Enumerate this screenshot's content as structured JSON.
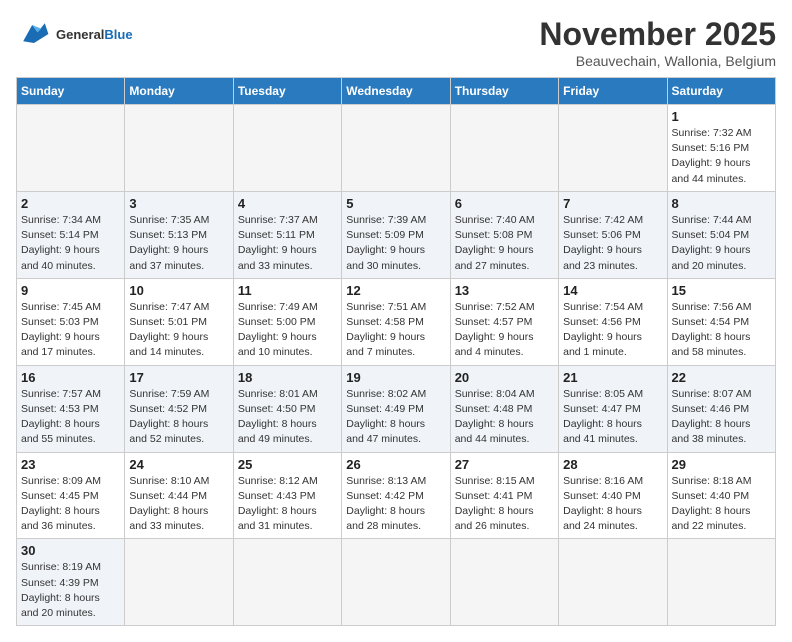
{
  "header": {
    "logo_general": "General",
    "logo_blue": "Blue",
    "month_title": "November 2025",
    "subtitle": "Beauvechain, Wallonia, Belgium"
  },
  "weekdays": [
    "Sunday",
    "Monday",
    "Tuesday",
    "Wednesday",
    "Thursday",
    "Friday",
    "Saturday"
  ],
  "weeks": [
    {
      "days": [
        {
          "num": "",
          "info": ""
        },
        {
          "num": "",
          "info": ""
        },
        {
          "num": "",
          "info": ""
        },
        {
          "num": "",
          "info": ""
        },
        {
          "num": "",
          "info": ""
        },
        {
          "num": "",
          "info": ""
        },
        {
          "num": "1",
          "info": "Sunrise: 7:32 AM\nSunset: 5:16 PM\nDaylight: 9 hours\nand 44 minutes."
        }
      ]
    },
    {
      "days": [
        {
          "num": "2",
          "info": "Sunrise: 7:34 AM\nSunset: 5:14 PM\nDaylight: 9 hours\nand 40 minutes."
        },
        {
          "num": "3",
          "info": "Sunrise: 7:35 AM\nSunset: 5:13 PM\nDaylight: 9 hours\nand 37 minutes."
        },
        {
          "num": "4",
          "info": "Sunrise: 7:37 AM\nSunset: 5:11 PM\nDaylight: 9 hours\nand 33 minutes."
        },
        {
          "num": "5",
          "info": "Sunrise: 7:39 AM\nSunset: 5:09 PM\nDaylight: 9 hours\nand 30 minutes."
        },
        {
          "num": "6",
          "info": "Sunrise: 7:40 AM\nSunset: 5:08 PM\nDaylight: 9 hours\nand 27 minutes."
        },
        {
          "num": "7",
          "info": "Sunrise: 7:42 AM\nSunset: 5:06 PM\nDaylight: 9 hours\nand 23 minutes."
        },
        {
          "num": "8",
          "info": "Sunrise: 7:44 AM\nSunset: 5:04 PM\nDaylight: 9 hours\nand 20 minutes."
        }
      ]
    },
    {
      "days": [
        {
          "num": "9",
          "info": "Sunrise: 7:45 AM\nSunset: 5:03 PM\nDaylight: 9 hours\nand 17 minutes."
        },
        {
          "num": "10",
          "info": "Sunrise: 7:47 AM\nSunset: 5:01 PM\nDaylight: 9 hours\nand 14 minutes."
        },
        {
          "num": "11",
          "info": "Sunrise: 7:49 AM\nSunset: 5:00 PM\nDaylight: 9 hours\nand 10 minutes."
        },
        {
          "num": "12",
          "info": "Sunrise: 7:51 AM\nSunset: 4:58 PM\nDaylight: 9 hours\nand 7 minutes."
        },
        {
          "num": "13",
          "info": "Sunrise: 7:52 AM\nSunset: 4:57 PM\nDaylight: 9 hours\nand 4 minutes."
        },
        {
          "num": "14",
          "info": "Sunrise: 7:54 AM\nSunset: 4:56 PM\nDaylight: 9 hours\nand 1 minute."
        },
        {
          "num": "15",
          "info": "Sunrise: 7:56 AM\nSunset: 4:54 PM\nDaylight: 8 hours\nand 58 minutes."
        }
      ]
    },
    {
      "days": [
        {
          "num": "16",
          "info": "Sunrise: 7:57 AM\nSunset: 4:53 PM\nDaylight: 8 hours\nand 55 minutes."
        },
        {
          "num": "17",
          "info": "Sunrise: 7:59 AM\nSunset: 4:52 PM\nDaylight: 8 hours\nand 52 minutes."
        },
        {
          "num": "18",
          "info": "Sunrise: 8:01 AM\nSunset: 4:50 PM\nDaylight: 8 hours\nand 49 minutes."
        },
        {
          "num": "19",
          "info": "Sunrise: 8:02 AM\nSunset: 4:49 PM\nDaylight: 8 hours\nand 47 minutes."
        },
        {
          "num": "20",
          "info": "Sunrise: 8:04 AM\nSunset: 4:48 PM\nDaylight: 8 hours\nand 44 minutes."
        },
        {
          "num": "21",
          "info": "Sunrise: 8:05 AM\nSunset: 4:47 PM\nDaylight: 8 hours\nand 41 minutes."
        },
        {
          "num": "22",
          "info": "Sunrise: 8:07 AM\nSunset: 4:46 PM\nDaylight: 8 hours\nand 38 minutes."
        }
      ]
    },
    {
      "days": [
        {
          "num": "23",
          "info": "Sunrise: 8:09 AM\nSunset: 4:45 PM\nDaylight: 8 hours\nand 36 minutes."
        },
        {
          "num": "24",
          "info": "Sunrise: 8:10 AM\nSunset: 4:44 PM\nDaylight: 8 hours\nand 33 minutes."
        },
        {
          "num": "25",
          "info": "Sunrise: 8:12 AM\nSunset: 4:43 PM\nDaylight: 8 hours\nand 31 minutes."
        },
        {
          "num": "26",
          "info": "Sunrise: 8:13 AM\nSunset: 4:42 PM\nDaylight: 8 hours\nand 28 minutes."
        },
        {
          "num": "27",
          "info": "Sunrise: 8:15 AM\nSunset: 4:41 PM\nDaylight: 8 hours\nand 26 minutes."
        },
        {
          "num": "28",
          "info": "Sunrise: 8:16 AM\nSunset: 4:40 PM\nDaylight: 8 hours\nand 24 minutes."
        },
        {
          "num": "29",
          "info": "Sunrise: 8:18 AM\nSunset: 4:40 PM\nDaylight: 8 hours\nand 22 minutes."
        }
      ]
    },
    {
      "days": [
        {
          "num": "30",
          "info": "Sunrise: 8:19 AM\nSunset: 4:39 PM\nDaylight: 8 hours\nand 20 minutes."
        },
        {
          "num": "",
          "info": ""
        },
        {
          "num": "",
          "info": ""
        },
        {
          "num": "",
          "info": ""
        },
        {
          "num": "",
          "info": ""
        },
        {
          "num": "",
          "info": ""
        },
        {
          "num": "",
          "info": ""
        }
      ]
    }
  ]
}
